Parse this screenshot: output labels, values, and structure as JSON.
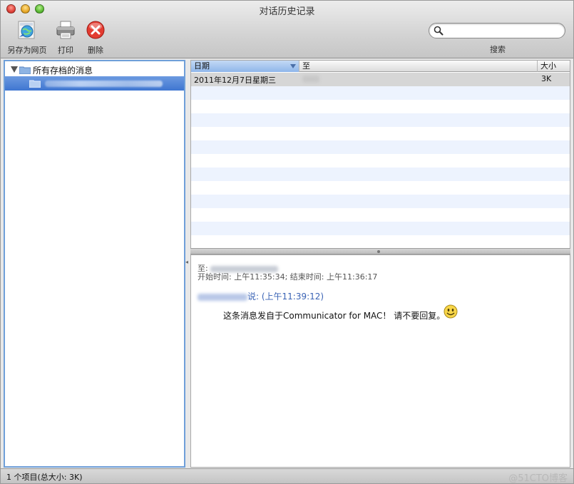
{
  "window": {
    "title": "对话历史记录"
  },
  "toolbar": {
    "save_web_label": "另存为网页",
    "print_label": "打印",
    "delete_label": "删除",
    "search_placeholder": "",
    "search_value": "",
    "search_label": "搜索"
  },
  "sidebar": {
    "root_label": "所有存档的消息",
    "selected_child_label": ""
  },
  "table": {
    "columns": [
      "日期",
      "至",
      "大小"
    ],
    "rows": [
      {
        "date": "2011年12月7日星期三",
        "to": "",
        "size": "3K"
      }
    ],
    "empty_rows": 11
  },
  "message": {
    "to_prefix": "至:",
    "time_line": "开始时间: 上午11:35:34;  结束时间: 上午11:36:17",
    "sender_suffix": "说: (上午11:39:12)",
    "body": "这条消息发自于Communicator for MAC！ 请不要回复。"
  },
  "status": {
    "summary": "1 个项目(总大小: 3K)",
    "watermark": "@51CTO博客"
  },
  "colors": {
    "selection_blue": "#3f76d1",
    "sender_blue": "#3a63b5",
    "stripe": "#edf3fe"
  }
}
